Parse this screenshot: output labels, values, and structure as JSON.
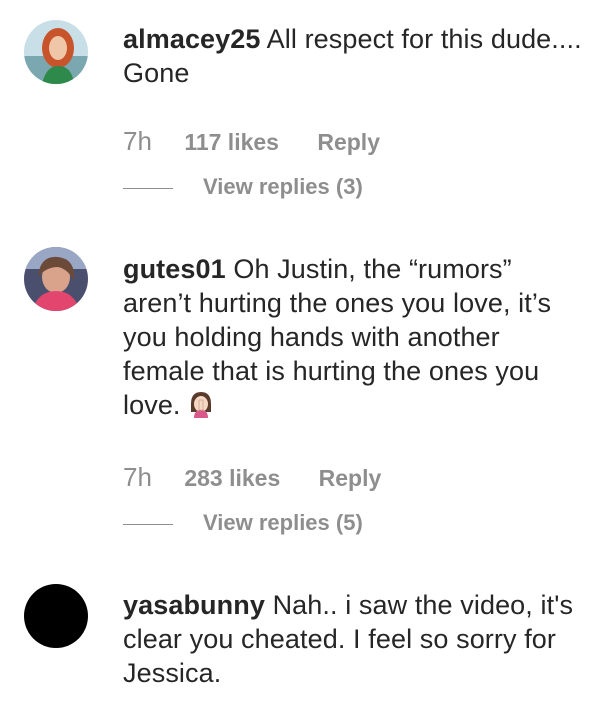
{
  "comments": [
    {
      "username": "almacey25",
      "text": "All respect for this dude.... Gone",
      "time": "7h",
      "likes": "117 likes",
      "reply": "Reply",
      "view_replies": "View replies (3)"
    },
    {
      "username": "gutes01",
      "text": "Oh Justin, the “rumors” aren’t hurting the ones you love, it’s you holding hands with another female that is hurting the ones you love.",
      "time": "7h",
      "likes": "283 likes",
      "reply": "Reply",
      "view_replies": "View replies (5)"
    },
    {
      "username": "yasabunny",
      "text": "Nah.. i saw the video, it's clear you cheated. I feel so sorry for Jessica."
    }
  ],
  "icons": {
    "emoji": "woman-facepalming-emoji"
  }
}
